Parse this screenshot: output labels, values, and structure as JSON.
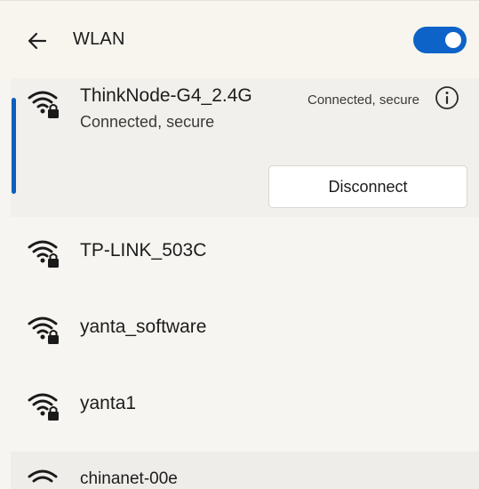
{
  "header": {
    "title": "WLAN",
    "back_icon": "arrow-left-icon",
    "toggle_state": "on",
    "accent_color": "#0d63c8"
  },
  "connected_network": {
    "name": "ThinkNode-G4_2.4G",
    "subtitle": "Connected, secure",
    "status_right": "Connected, secure",
    "disconnect_label": "Disconnect",
    "info_icon": "info-icon",
    "wifi_icon": "wifi-secured-icon"
  },
  "networks": [
    {
      "name": "TP-LINK_503C",
      "icon": "wifi-secured-icon"
    },
    {
      "name": "yanta_software",
      "icon": "wifi-secured-icon"
    },
    {
      "name": "yanta1",
      "icon": "wifi-secured-icon"
    },
    {
      "name": "chinanet-00e",
      "icon": "wifi-icon"
    }
  ]
}
